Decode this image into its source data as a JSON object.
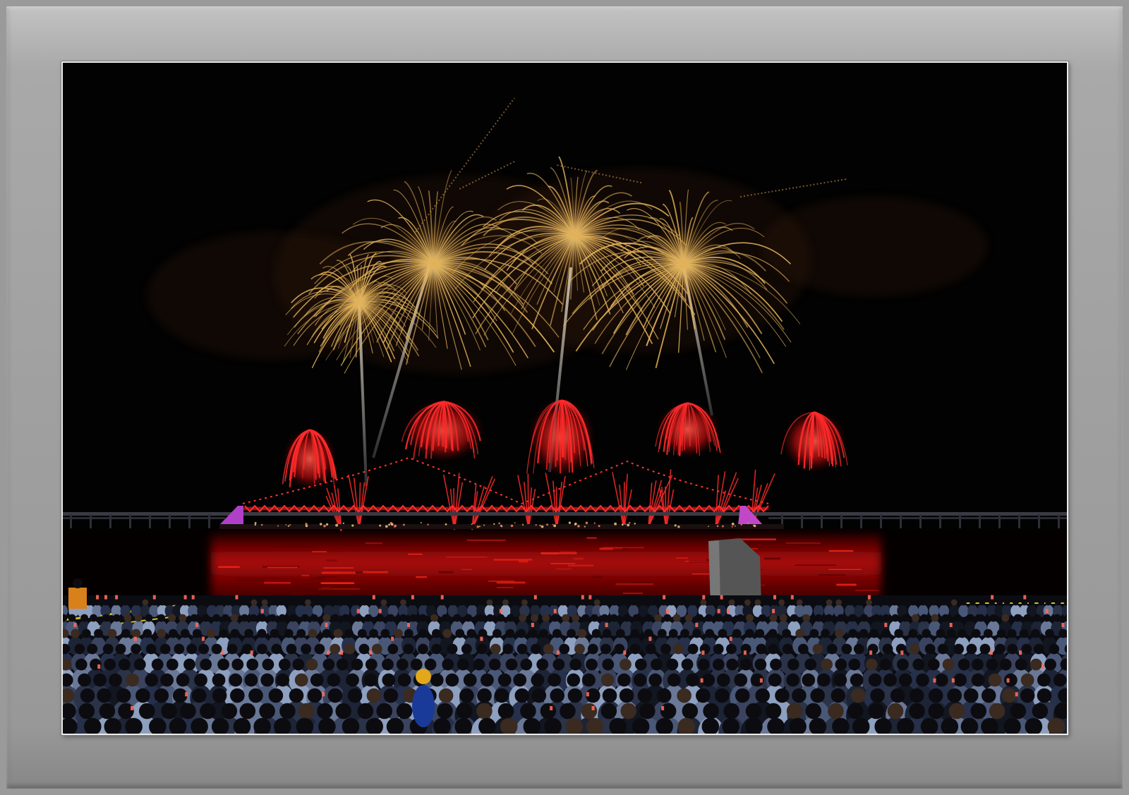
{
  "image": {
    "subject": "fireworks-over-bridge",
    "colors": {
      "mat": "#a0a0a0",
      "sky": "#020202",
      "firework_gold": "#e2b35a",
      "firework_red": "#ff2a2a",
      "bridge_lights": "#ff2b2b",
      "tower_lights": "#c040d0",
      "water_reflection": "#d00d0d"
    }
  }
}
